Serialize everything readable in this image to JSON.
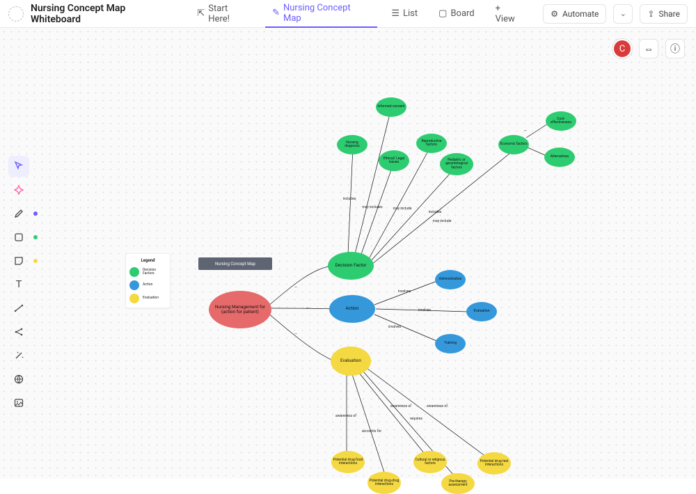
{
  "topbar": {
    "title": "Nursing Concept Map Whiteboard",
    "tabs": {
      "start": "Start Here!",
      "map": "Nursing Concept Map",
      "list": "List",
      "board": "Board",
      "addview": "+ View"
    },
    "automate": "Automate",
    "share": "Share"
  },
  "floating": {
    "avatar": "C"
  },
  "legend": {
    "title": "Legend",
    "decision": "Decision Factors",
    "action": "Action",
    "evaluation": "Evaluation"
  },
  "titlebox": "Nursing Concept Map",
  "nodes": {
    "root": "Nursing Management for (action for patient)",
    "decision_factor": "Decision Factor",
    "action": "Action",
    "evaluation": "Evaluation",
    "nursing_diag": "Nursing diagnosis",
    "informed": "Informed consent",
    "ethical": "Ethical/ Legal Issues",
    "reproductive": "Reproductive factors",
    "pediatric": "Pediatric or gerontological factors",
    "economic": "Economic factors",
    "cost": "Cost-effectiveness",
    "alternatives": "Alternatives",
    "administration": "Administration",
    "evaluation2": "Evaluation",
    "training": "Training",
    "drugfood": "Potential drug-food interactions",
    "drugdrug": "Potential drug-drug interactions",
    "cultural": "Cultural or religious factors",
    "pretherapy": "Pre-therapy assessment",
    "drugtest": "Potential drug test interactions"
  },
  "edge_labels": {
    "includes": "includes",
    "may_includes": "may includes",
    "may_include": "may include",
    "involves": "involves",
    "awareness_of": "awareness of",
    "accounts_for": "accounts for",
    "requires": "requires"
  }
}
